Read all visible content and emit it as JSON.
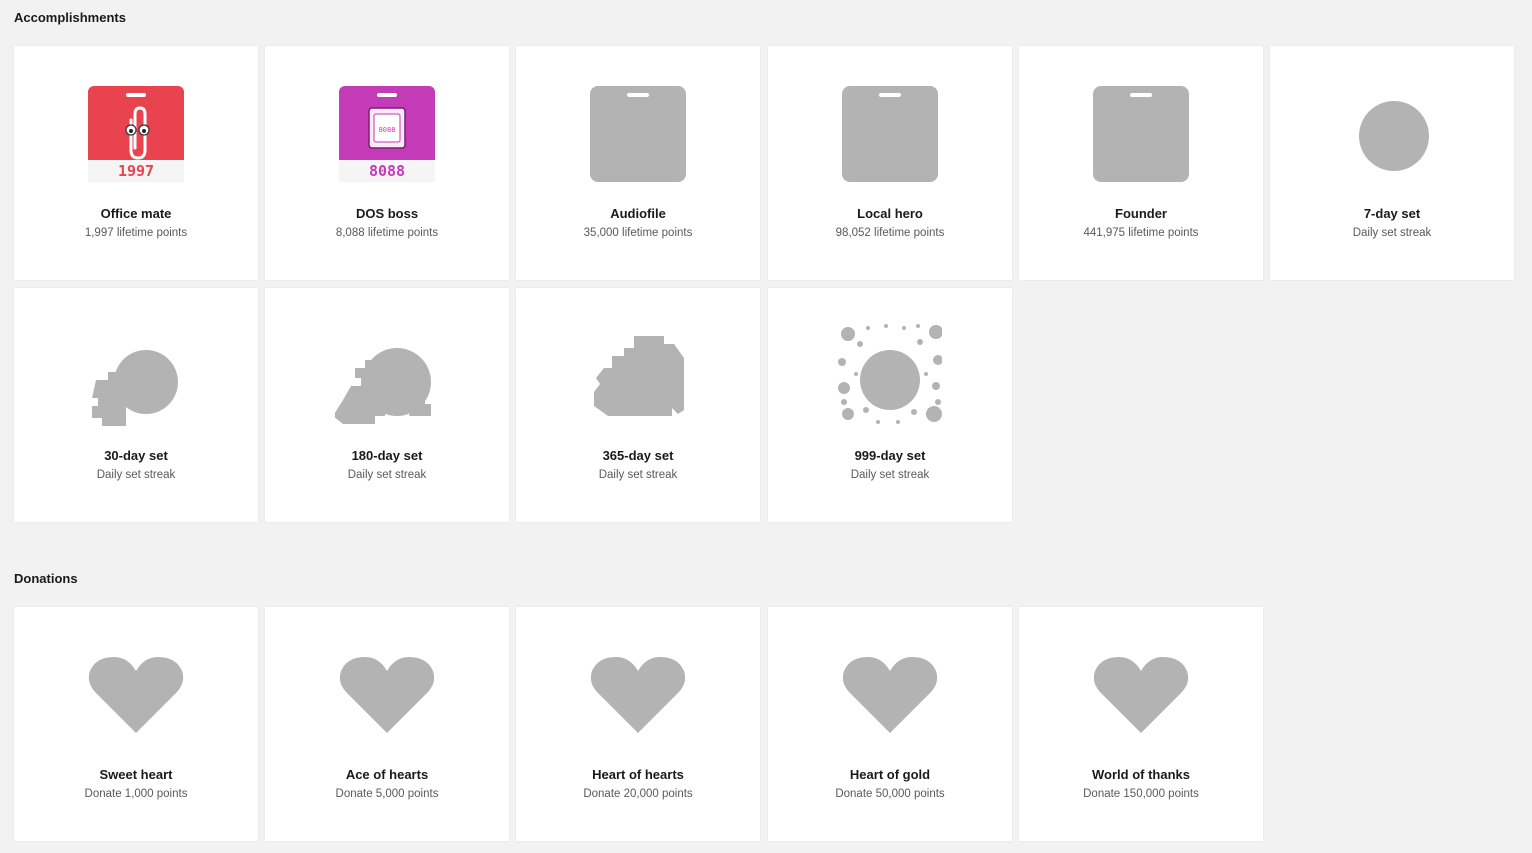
{
  "sections": [
    {
      "title": "Accomplishments",
      "cards": [
        {
          "title": "Office mate",
          "subtitle": "1,997 lifetime points",
          "icon": "office-mate-badge-icon",
          "badge_text": "1997"
        },
        {
          "title": "DOS boss",
          "subtitle": "8,088 lifetime points",
          "icon": "dos-boss-badge-icon",
          "badge_text": "8088",
          "chip_text": "8088"
        },
        {
          "title": "Audiofile",
          "subtitle": "35,000 lifetime points",
          "icon": "locked-badge-icon"
        },
        {
          "title": "Local hero",
          "subtitle": "98,052 lifetime points",
          "icon": "locked-badge-icon"
        },
        {
          "title": "Founder",
          "subtitle": "441,975 lifetime points",
          "icon": "locked-badge-icon"
        },
        {
          "title": "7-day set",
          "subtitle": "Daily set streak",
          "icon": "locked-circle-icon"
        },
        {
          "title": "30-day set",
          "subtitle": "Daily set streak",
          "icon": "locked-streak-30-icon"
        },
        {
          "title": "180-day set",
          "subtitle": "Daily set streak",
          "icon": "locked-streak-180-icon"
        },
        {
          "title": "365-day set",
          "subtitle": "Daily set streak",
          "icon": "locked-streak-365-icon"
        },
        {
          "title": "999-day set",
          "subtitle": "Daily set streak",
          "icon": "locked-streak-999-icon"
        }
      ]
    },
    {
      "title": "Donations",
      "cards": [
        {
          "title": "Sweet heart",
          "subtitle": "Donate 1,000 points",
          "icon": "heart-icon"
        },
        {
          "title": "Ace of hearts",
          "subtitle": "Donate 5,000 points",
          "icon": "heart-icon"
        },
        {
          "title": "Heart of hearts",
          "subtitle": "Donate 20,000 points",
          "icon": "heart-icon"
        },
        {
          "title": "Heart of gold",
          "subtitle": "Donate 50,000 points",
          "icon": "heart-icon"
        },
        {
          "title": "World of thanks",
          "subtitle": "Donate 150,000 points",
          "icon": "heart-icon"
        }
      ]
    }
  ],
  "colors": {
    "page_bg": "#f2f2f2",
    "card_bg": "#ffffff",
    "locked_gray": "#b3b3b3",
    "office_mate_red": "#e8434f",
    "dos_boss_magenta": "#c33bb6"
  }
}
